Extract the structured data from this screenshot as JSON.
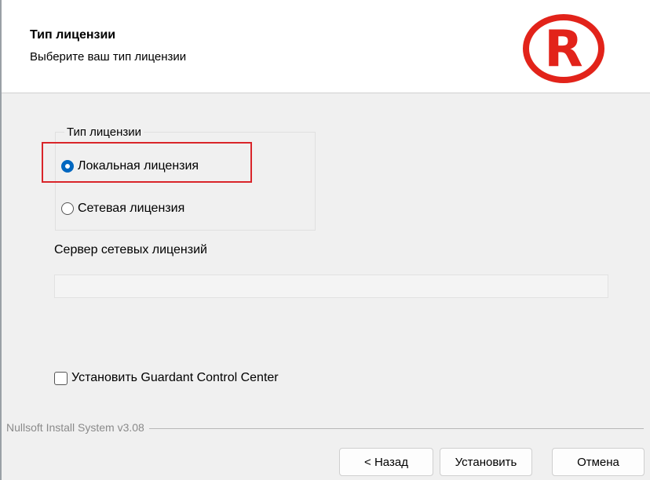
{
  "header": {
    "title": "Тип лицензии",
    "subtitle": "Выберите ваш тип лицензии",
    "logo": {
      "icon": "r-logo-icon",
      "letter": "R",
      "color": "#e2231a"
    }
  },
  "license_group": {
    "legend": "Тип лицензии",
    "options": [
      {
        "label": "Локальная лицензия",
        "selected": true
      },
      {
        "label": "Сетевая лицензия",
        "selected": false
      }
    ],
    "highlight_color": "#d9252a"
  },
  "server": {
    "label": "Сервер сетевых лицензий",
    "value": ""
  },
  "checkbox": {
    "label": "Установить Guardant Control Center",
    "checked": false
  },
  "footer": {
    "branding": "Nullsoft Install System v3.08"
  },
  "buttons": {
    "back": "< Назад",
    "install": "Установить",
    "cancel": "Отмена"
  },
  "colors": {
    "accent": "#0067c0",
    "background": "#f0f0f0"
  }
}
